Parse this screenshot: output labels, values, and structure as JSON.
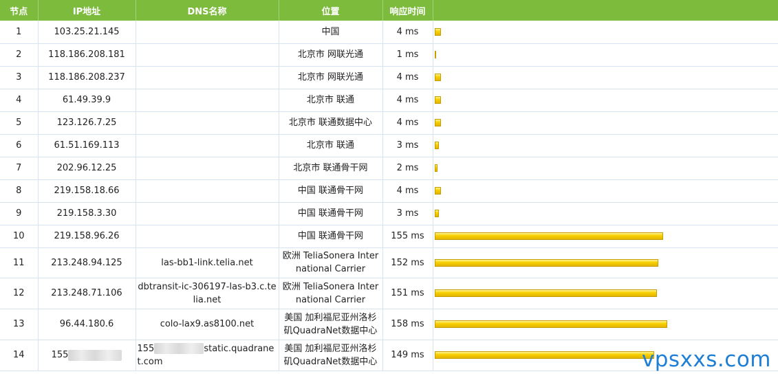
{
  "headers": {
    "hop": "节点",
    "ip": "IP地址",
    "dns": "DNS名称",
    "location": "位置",
    "time": "响应时间"
  },
  "rows": [
    {
      "hop": "1",
      "ip": "103.25.21.145",
      "dns": "",
      "location": "中国",
      "time": "4 ms",
      "ms": 4
    },
    {
      "hop": "2",
      "ip": "118.186.208.181",
      "dns": "",
      "location": "北京市 网联光通",
      "time": "1 ms",
      "ms": 1
    },
    {
      "hop": "3",
      "ip": "118.186.208.237",
      "dns": "",
      "location": "北京市 网联光通",
      "time": "4 ms",
      "ms": 4
    },
    {
      "hop": "4",
      "ip": "61.49.39.9",
      "dns": "",
      "location": "北京市 联通",
      "time": "4 ms",
      "ms": 4
    },
    {
      "hop": "5",
      "ip": "123.126.7.25",
      "dns": "",
      "location": "北京市 联通数据中心",
      "time": "4 ms",
      "ms": 4
    },
    {
      "hop": "6",
      "ip": "61.51.169.113",
      "dns": "",
      "location": "北京市 联通",
      "time": "3 ms",
      "ms": 3
    },
    {
      "hop": "7",
      "ip": "202.96.12.25",
      "dns": "",
      "location": "北京市 联通骨干网",
      "time": "2 ms",
      "ms": 2
    },
    {
      "hop": "8",
      "ip": "219.158.18.66",
      "dns": "",
      "location": "中国 联通骨干网",
      "time": "4 ms",
      "ms": 4
    },
    {
      "hop": "9",
      "ip": "219.158.3.30",
      "dns": "",
      "location": "中国 联通骨干网",
      "time": "3 ms",
      "ms": 3
    },
    {
      "hop": "10",
      "ip": "219.158.96.26",
      "dns": "",
      "location": "中国 联通骨干网",
      "time": "155 ms",
      "ms": 155
    },
    {
      "hop": "11",
      "ip": "213.248.94.125",
      "dns": "las-bb1-link.telia.net",
      "location": "欧洲 TeliaSonera International Carrier",
      "time": "152 ms",
      "ms": 152
    },
    {
      "hop": "12",
      "ip": "213.248.71.106",
      "dns": "dbtransit-ic-306197-las-b3.c.telia.net",
      "location": "欧洲 TeliaSonera International Carrier",
      "time": "151 ms",
      "ms": 151
    },
    {
      "hop": "13",
      "ip": "96.44.180.6",
      "dns": "colo-lax9.as8100.net",
      "location": "美国 加利福尼亚州洛杉矶QuadraNet数据中心",
      "time": "158 ms",
      "ms": 158
    },
    {
      "hop": "14",
      "ip": "155",
      "dns": "155",
      "dns_suffix": "static.quadranet.com",
      "location": "美国 加利福尼亚州洛杉矶QuadraNet数据中心",
      "time": "149 ms",
      "ms": 149,
      "masked": true
    }
  ],
  "bar_scale_max_ms": 158,
  "colors": {
    "header_bg": "#7dbb3c",
    "bar": "#f7d100",
    "grid": "#d6e3f0",
    "watermark": "#1f7fd6"
  },
  "watermark": "vpsxxs.com"
}
